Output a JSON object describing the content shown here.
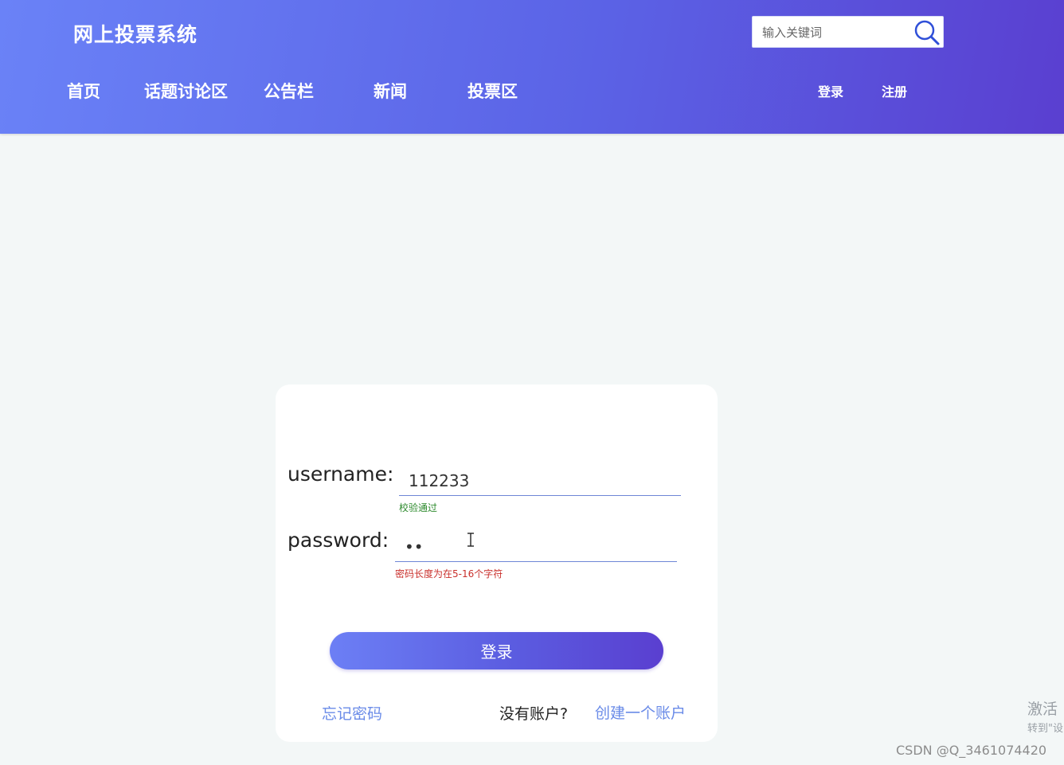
{
  "header": {
    "site_title": "网上投票系统",
    "search": {
      "placeholder": "输入关键词",
      "icon": "search-icon"
    },
    "nav": [
      "首页",
      "话题讨论区",
      "公告栏",
      "新闻",
      "投票区"
    ],
    "auth": {
      "login": "登录",
      "register": "注册"
    }
  },
  "login_form": {
    "username_label": "username:",
    "username_value": "112233",
    "username_hint": "校验通过",
    "password_label": "password:",
    "password_value": "••",
    "password_hint": "密码长度为在5-16个字符",
    "submit_label": "登录",
    "forgot_link": "忘记密码",
    "no_account_text": "没有账户?",
    "create_link": "创建一个账户"
  },
  "overlays": {
    "activate_text": "激活",
    "activate_sub": "转到\"设",
    "csdn_watermark": "CSDN @Q_3461074420"
  },
  "colors": {
    "header_gradient_start": "#6a82f7",
    "header_gradient_end": "#5a3fd0",
    "link_blue": "#6a8be8",
    "hint_ok": "#2e8b2e",
    "hint_error": "#c9302c"
  }
}
